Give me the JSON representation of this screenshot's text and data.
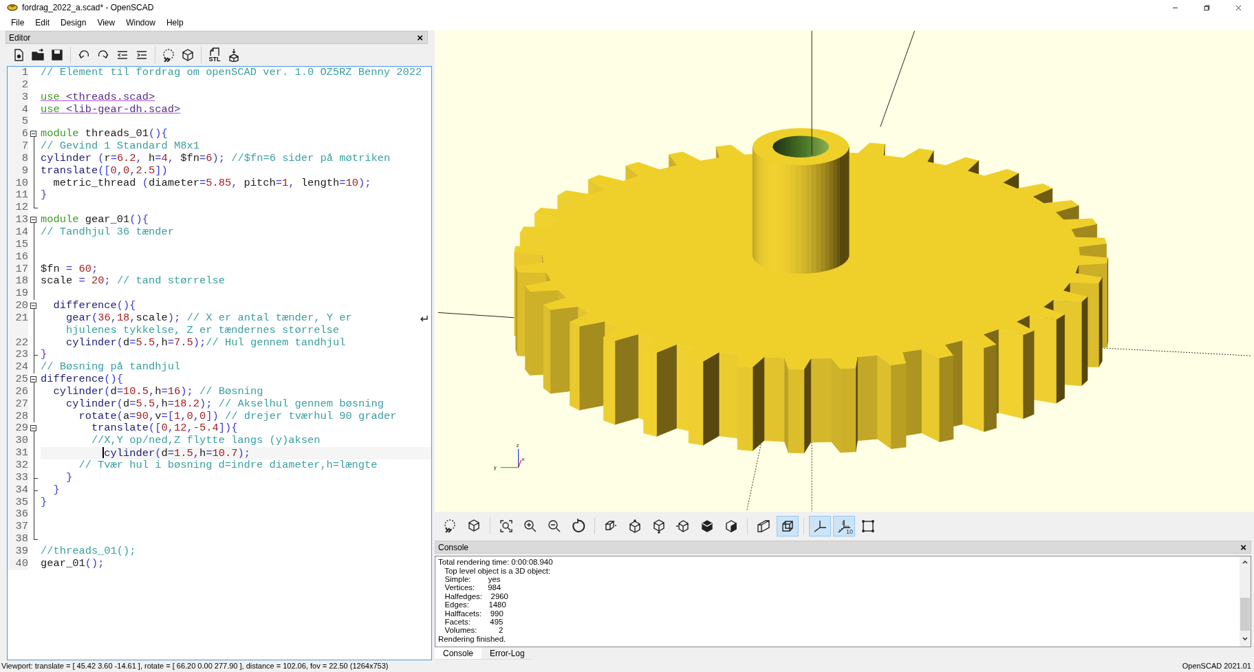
{
  "window": {
    "title": "fordrag_2022_a.scad* - OpenSCAD"
  },
  "menu": [
    "File",
    "Edit",
    "Design",
    "View",
    "Window",
    "Help"
  ],
  "editor": {
    "title": "Editor",
    "close": "×",
    "stl_label": "STL",
    "lines": [
      {
        "number": "1",
        "kind": "plain",
        "current": false,
        "tokens": [
          {
            "kind": "comment",
            "text": "// Element til fordrag om openSCAD ver. 1.0 OZ5RZ Benny 2022"
          }
        ]
      },
      {
        "number": "2",
        "kind": "plain",
        "current": false
      },
      {
        "number": "3",
        "kind": "plain",
        "current": false,
        "tokens": [
          {
            "kind": "use",
            "text": "use "
          },
          {
            "kind": "include",
            "text": "<threads.scad>"
          }
        ]
      },
      {
        "number": "4",
        "kind": "plain",
        "current": false,
        "tokens": [
          {
            "kind": "use",
            "text": "use "
          },
          {
            "kind": "include",
            "text": "<lib-gear-dh.scad>"
          }
        ]
      },
      {
        "number": "5",
        "kind": "plain",
        "current": false
      },
      {
        "number": "6",
        "kind": "fold-start",
        "current": false,
        "tokens": [
          {
            "kind": "keyword",
            "text": "module"
          },
          {
            "kind": "ident",
            "text": " threads_01"
          },
          {
            "kind": "punct",
            "text": "(){"
          }
        ]
      },
      {
        "number": "7",
        "kind": "fold-line",
        "current": false,
        "tokens": [
          {
            "kind": "comment",
            "text": "// Gevind 1 Standard M8x1"
          }
        ]
      },
      {
        "number": "8",
        "kind": "fold-line",
        "current": false,
        "tokens": [
          {
            "kind": "builtin",
            "text": "cylinder"
          },
          {
            "kind": "punct",
            "text": " ("
          },
          {
            "kind": "ident",
            "text": "r"
          },
          {
            "kind": "punct",
            "text": "="
          },
          {
            "kind": "number",
            "text": "6.2"
          },
          {
            "kind": "punct",
            "text": ", "
          },
          {
            "kind": "ident",
            "text": "h"
          },
          {
            "kind": "punct",
            "text": "="
          },
          {
            "kind": "number",
            "text": "4"
          },
          {
            "kind": "punct",
            "text": ", "
          },
          {
            "kind": "ident",
            "text": "$fn"
          },
          {
            "kind": "punct",
            "text": "="
          },
          {
            "kind": "number",
            "text": "6"
          },
          {
            "kind": "punct",
            "text": "); "
          },
          {
            "kind": "comment",
            "text": "//$fn=6 sider på møtriken"
          }
        ]
      },
      {
        "number": "9",
        "kind": "fold-line",
        "current": false,
        "tokens": [
          {
            "kind": "builtin",
            "text": "translate"
          },
          {
            "kind": "punct",
            "text": "(["
          },
          {
            "kind": "number",
            "text": "0"
          },
          {
            "kind": "punct",
            "text": ","
          },
          {
            "kind": "number",
            "text": "0"
          },
          {
            "kind": "punct",
            "text": ","
          },
          {
            "kind": "number",
            "text": "2.5"
          },
          {
            "kind": "punct",
            "text": "])"
          }
        ]
      },
      {
        "number": "10",
        "kind": "fold-line",
        "current": false,
        "tokens": [
          {
            "kind": "ident",
            "text": "  metric_thread"
          },
          {
            "kind": "punct",
            "text": " ("
          },
          {
            "kind": "ident",
            "text": "diameter"
          },
          {
            "kind": "punct",
            "text": "="
          },
          {
            "kind": "number",
            "text": "5.85"
          },
          {
            "kind": "punct",
            "text": ", "
          },
          {
            "kind": "ident",
            "text": "pitch"
          },
          {
            "kind": "punct",
            "text": "="
          },
          {
            "kind": "number",
            "text": "1"
          },
          {
            "kind": "punct",
            "text": ", "
          },
          {
            "kind": "ident",
            "text": "length"
          },
          {
            "kind": "punct",
            "text": "="
          },
          {
            "kind": "number",
            "text": "10"
          },
          {
            "kind": "punct",
            "text": ");"
          }
        ]
      },
      {
        "number": "11",
        "kind": "fold-line",
        "current": false,
        "tokens": [
          {
            "kind": "punct",
            "text": "}"
          }
        ]
      },
      {
        "number": "12",
        "kind": "fold-end",
        "current": false
      },
      {
        "number": "13",
        "kind": "fold-start",
        "current": false,
        "tokens": [
          {
            "kind": "keyword",
            "text": "module"
          },
          {
            "kind": "ident",
            "text": " gear_01"
          },
          {
            "kind": "punct",
            "text": "(){"
          }
        ]
      },
      {
        "number": "14",
        "kind": "fold-line",
        "current": false,
        "tokens": [
          {
            "kind": "comment",
            "text": "// Tandhjul 36 tænder"
          }
        ]
      },
      {
        "number": "15",
        "kind": "fold-line",
        "current": false
      },
      {
        "number": "16",
        "kind": "fold-line",
        "current": false
      },
      {
        "number": "17",
        "kind": "fold-line",
        "current": false,
        "tokens": [
          {
            "kind": "ident",
            "text": "$fn"
          },
          {
            "kind": "punct",
            "text": " = "
          },
          {
            "kind": "number",
            "text": "60"
          },
          {
            "kind": "punct",
            "text": ";"
          }
        ]
      },
      {
        "number": "18",
        "kind": "fold-line",
        "current": false,
        "tokens": [
          {
            "kind": "ident",
            "text": "scale"
          },
          {
            "kind": "punct",
            "text": " = "
          },
          {
            "kind": "number",
            "text": "20"
          },
          {
            "kind": "punct",
            "text": "; "
          },
          {
            "kind": "comment",
            "text": "// tand størrelse"
          }
        ]
      },
      {
        "number": "19",
        "kind": "fold-line",
        "current": false
      },
      {
        "number": "20",
        "kind": "fold-start",
        "current": false,
        "tokens": [
          {
            "kind": "builtin",
            "text": "  difference"
          },
          {
            "kind": "punct",
            "text": "(){"
          }
        ]
      },
      {
        "number": "21",
        "kind": "fold-line",
        "current": false,
        "tokens": [
          {
            "kind": "builtin",
            "text": "    gear"
          },
          {
            "kind": "punct",
            "text": "("
          },
          {
            "kind": "number",
            "text": "36"
          },
          {
            "kind": "punct",
            "text": ","
          },
          {
            "kind": "number",
            "text": "18"
          },
          {
            "kind": "punct",
            "text": ","
          },
          {
            "kind": "ident",
            "text": "scale"
          },
          {
            "kind": "punct",
            "text": "); "
          },
          {
            "kind": "comment",
            "text": "// X er antal tænder, Y er"
          }
        ],
        "continuation": [
          {
            "kind": "comment",
            "text": "    hjulenes tykkelse, Z er tændernes størrelse"
          }
        ]
      },
      {
        "number": "22",
        "kind": "fold-line",
        "current": false,
        "tokens": [
          {
            "kind": "builtin",
            "text": "    cylinder"
          },
          {
            "kind": "punct",
            "text": "("
          },
          {
            "kind": "ident",
            "text": "d"
          },
          {
            "kind": "punct",
            "text": "="
          },
          {
            "kind": "number",
            "text": "5.5"
          },
          {
            "kind": "punct",
            "text": ","
          },
          {
            "kind": "ident",
            "text": "h"
          },
          {
            "kind": "punct",
            "text": "="
          },
          {
            "kind": "number",
            "text": "7.5"
          },
          {
            "kind": "punct",
            "text": ");"
          },
          {
            "kind": "comment",
            "text": "// Hul gennem tandhjul"
          }
        ]
      },
      {
        "number": "23",
        "kind": "fold-tee",
        "current": false,
        "tokens": [
          {
            "kind": "punct",
            "text": "}"
          }
        ]
      },
      {
        "number": "24",
        "kind": "fold-line",
        "current": false,
        "tokens": [
          {
            "kind": "comment",
            "text": "// Bøsning på tandhjul"
          }
        ]
      },
      {
        "number": "25",
        "kind": "fold-start",
        "current": false,
        "tokens": [
          {
            "kind": "builtin",
            "text": "difference"
          },
          {
            "kind": "punct",
            "text": "(){"
          }
        ]
      },
      {
        "number": "26",
        "kind": "fold-line",
        "current": false,
        "tokens": [
          {
            "kind": "builtin",
            "text": "  cylinder"
          },
          {
            "kind": "punct",
            "text": "("
          },
          {
            "kind": "ident",
            "text": "d"
          },
          {
            "kind": "punct",
            "text": "="
          },
          {
            "kind": "number",
            "text": "10.5"
          },
          {
            "kind": "punct",
            "text": ","
          },
          {
            "kind": "ident",
            "text": "h"
          },
          {
            "kind": "punct",
            "text": "="
          },
          {
            "kind": "number",
            "text": "16"
          },
          {
            "kind": "punct",
            "text": "); "
          },
          {
            "kind": "comment",
            "text": "// Bøsning"
          }
        ]
      },
      {
        "number": "27",
        "kind": "fold-line",
        "current": false,
        "tokens": [
          {
            "kind": "builtin",
            "text": "    cylinder"
          },
          {
            "kind": "punct",
            "text": "("
          },
          {
            "kind": "ident",
            "text": "d"
          },
          {
            "kind": "punct",
            "text": "="
          },
          {
            "kind": "number",
            "text": "5.5"
          },
          {
            "kind": "punct",
            "text": ","
          },
          {
            "kind": "ident",
            "text": "h"
          },
          {
            "kind": "punct",
            "text": "="
          },
          {
            "kind": "number",
            "text": "18.2"
          },
          {
            "kind": "punct",
            "text": "); "
          },
          {
            "kind": "comment",
            "text": "// Akselhul gennem bøsning"
          }
        ]
      },
      {
        "number": "28",
        "kind": "fold-line",
        "current": false,
        "tokens": [
          {
            "kind": "builtin",
            "text": "      rotate"
          },
          {
            "kind": "punct",
            "text": "("
          },
          {
            "kind": "ident",
            "text": "a"
          },
          {
            "kind": "punct",
            "text": "="
          },
          {
            "kind": "number",
            "text": "90"
          },
          {
            "kind": "punct",
            "text": ","
          },
          {
            "kind": "ident",
            "text": "v"
          },
          {
            "kind": "punct",
            "text": "=["
          },
          {
            "kind": "number",
            "text": "1"
          },
          {
            "kind": "punct",
            "text": ","
          },
          {
            "kind": "number",
            "text": "0"
          },
          {
            "kind": "punct",
            "text": ","
          },
          {
            "kind": "number",
            "text": "0"
          },
          {
            "kind": "punct",
            "text": "]) "
          },
          {
            "kind": "comment",
            "text": "// drejer tværhul 90 grader"
          }
        ]
      },
      {
        "number": "29",
        "kind": "fold-start",
        "current": false,
        "tokens": [
          {
            "kind": "builtin",
            "text": "        translate"
          },
          {
            "kind": "punct",
            "text": "(["
          },
          {
            "kind": "number",
            "text": "0"
          },
          {
            "kind": "punct",
            "text": ","
          },
          {
            "kind": "number",
            "text": "12"
          },
          {
            "kind": "punct",
            "text": ","
          },
          {
            "kind": "number",
            "text": "-5.4"
          },
          {
            "kind": "punct",
            "text": "]){"
          }
        ]
      },
      {
        "number": "30",
        "kind": "fold-line",
        "current": false,
        "tokens": [
          {
            "kind": "comment",
            "text": "        //X,Y op/ned,Z flytte langs (y)aksen"
          }
        ]
      },
      {
        "number": "31",
        "kind": "fold-line",
        "current": true,
        "tokens": [
          {
            "kind": "builtin",
            "text": "          cylinder"
          },
          {
            "kind": "punct",
            "text": "("
          },
          {
            "kind": "ident",
            "text": "d"
          },
          {
            "kind": "punct",
            "text": "="
          },
          {
            "kind": "number",
            "text": "1.5"
          },
          {
            "kind": "punct",
            "text": ","
          },
          {
            "kind": "ident",
            "text": "h"
          },
          {
            "kind": "punct",
            "text": "="
          },
          {
            "kind": "number",
            "text": "10.7"
          },
          {
            "kind": "punct",
            "text": ");"
          }
        ]
      },
      {
        "number": "32",
        "kind": "fold-line",
        "current": false,
        "tokens": [
          {
            "kind": "comment",
            "text": "      // Tvær hul i bøsning d=indre diameter,h=længte"
          }
        ]
      },
      {
        "number": "33",
        "kind": "fold-tee",
        "current": false,
        "tokens": [
          {
            "kind": "punct",
            "text": "    }"
          }
        ]
      },
      {
        "number": "34",
        "kind": "fold-tee",
        "current": false,
        "tokens": [
          {
            "kind": "punct",
            "text": "  }"
          }
        ]
      },
      {
        "number": "35",
        "kind": "fold-line",
        "current": false,
        "tokens": [
          {
            "kind": "punct",
            "text": "}"
          }
        ]
      },
      {
        "number": "36",
        "kind": "fold-line",
        "current": false
      },
      {
        "number": "37",
        "kind": "fold-line",
        "current": false
      },
      {
        "number": "38",
        "kind": "fold-end",
        "current": false
      },
      {
        "number": "39",
        "kind": "plain",
        "current": false,
        "tokens": [
          {
            "kind": "comment",
            "text": "//threads_01();"
          }
        ]
      },
      {
        "number": "40",
        "kind": "plain",
        "current": false,
        "tokens": [
          {
            "kind": "ident",
            "text": "gear_01"
          },
          {
            "kind": "punct",
            "text": "();"
          }
        ]
      }
    ]
  },
  "viewport": {
    "axis_labels": {
      "z": "z",
      "x": "x",
      "y": "y"
    }
  },
  "view_toolbar": {
    "scale_label": "10",
    "buttons": [
      {
        "selected": false
      },
      {
        "selected": false
      },
      {
        "selected": false
      },
      {
        "selected": false
      },
      {
        "selected": false
      },
      {
        "selected": false
      },
      {
        "selected": false
      },
      {
        "selected": false
      },
      {
        "selected": false
      },
      {
        "selected": false
      },
      {
        "selected": false
      },
      {
        "selected": false
      },
      {
        "selected": false
      },
      {
        "selected": true
      },
      {
        "selected": true
      },
      {
        "selected": true
      },
      {
        "selected": false
      }
    ]
  },
  "console": {
    "title": "Console",
    "close": "×",
    "lines": [
      "Total rendering time: 0:00:08.940",
      "   Top level object is a 3D object:",
      "   Simple:        yes",
      "   Vertices:      984",
      "   Halfedges:    2960",
      "   Edges:         1480",
      "   Halffacets:    990",
      "   Facets:         495",
      "   Volumes:          2",
      "Rendering finished."
    ],
    "tabs": [
      {
        "label": "Console",
        "selected": true
      },
      {
        "label": "Error-Log",
        "selected": false
      }
    ]
  },
  "status_bar": {
    "viewport": "Viewport: translate = [ 45.42 3.60 -14.61 ], rotate = [ 66.20 0.00 277.90 ], distance = 102.06, fov = 22.50 (1264x753)",
    "version": "OpenSCAD 2021.01"
  }
}
